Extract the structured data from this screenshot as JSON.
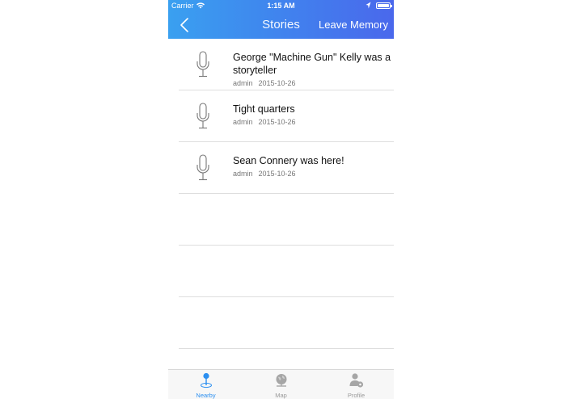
{
  "status_bar": {
    "carrier": "Carrier",
    "time": "1:15 AM"
  },
  "nav": {
    "title": "Stories",
    "action": "Leave Memory"
  },
  "stories": [
    {
      "title": "George \"Machine Gun\" Kelly was a storyteller",
      "author": "admin",
      "date": "2015-10-26"
    },
    {
      "title": "Tight quarters",
      "author": "admin",
      "date": "2015-10-26"
    },
    {
      "title": "Sean Connery was here!",
      "author": "admin",
      "date": "2015-10-26"
    }
  ],
  "tabs": [
    {
      "label": "Nearby",
      "icon": "nearby-pin-icon",
      "active": true
    },
    {
      "label": "Map",
      "icon": "globe-icon",
      "active": false
    },
    {
      "label": "Profile",
      "icon": "profile-gear-icon",
      "active": false
    }
  ],
  "colors": {
    "accent": "#2c8ff0",
    "header_start": "#3aa0f0",
    "header_end": "#4a68ec",
    "inactive": "#9a9a9a"
  }
}
